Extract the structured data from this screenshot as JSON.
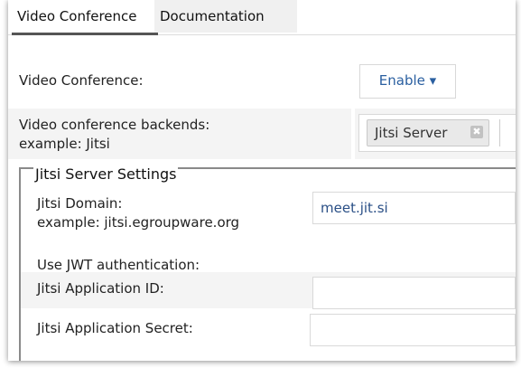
{
  "tabs": [
    {
      "label": "Video Conference",
      "active": true
    },
    {
      "label": "Documentation",
      "active": false
    }
  ],
  "video_conference": {
    "label": "Video Conference:",
    "select_value": "Enable ▾"
  },
  "backends": {
    "label_line1": "Video conference backends:",
    "label_line2": "example: Jitsi",
    "selected_tag": "Jitsi Server",
    "remove_icon": "close-icon"
  },
  "jitsi_settings": {
    "legend": "Jitsi Server Settings",
    "domain_label_line1": "Jitsi Domain:",
    "domain_label_line2": "example: jitsi.egroupware.org",
    "domain_value": "meet.jit.si",
    "jwt_label": "Use JWT authentication:",
    "app_id_label": "Jitsi Application ID:",
    "app_id_value": "",
    "app_secret_label": "Jitsi Application Secret:",
    "app_secret_value": ""
  },
  "colors": {
    "link_blue": "#2a5fa0",
    "tab_active_border": "#555555"
  }
}
